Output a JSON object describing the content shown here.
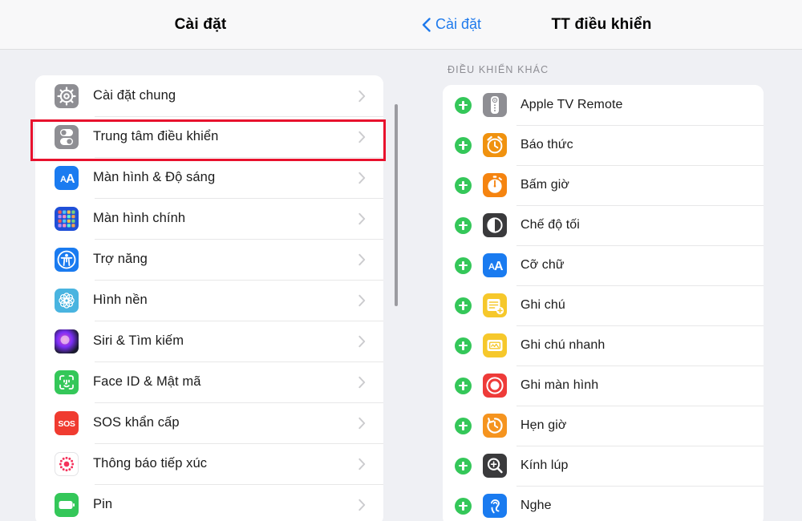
{
  "left_panel": {
    "nav": {
      "title": "Cài đặt"
    },
    "items": [
      {
        "label": "Cài đặt chung",
        "icon": "gear-icon",
        "icon_class": "ic-gear",
        "highlighted": false
      },
      {
        "label": "Trung tâm điều khiển",
        "icon": "control-center-icon",
        "icon_class": "ic-cc",
        "highlighted": true
      },
      {
        "label": "Màn hình & Độ sáng",
        "icon": "display-brightness-icon",
        "icon_class": "ic-aa",
        "highlighted": false
      },
      {
        "label": "Màn hình chính",
        "icon": "home-screen-icon",
        "icon_class": "ic-home",
        "highlighted": false
      },
      {
        "label": "Trợ năng",
        "icon": "accessibility-icon",
        "icon_class": "ic-acc",
        "highlighted": false
      },
      {
        "label": "Hình nền",
        "icon": "wallpaper-icon",
        "icon_class": "ic-wall",
        "highlighted": false
      },
      {
        "label": "Siri & Tìm kiếm",
        "icon": "siri-icon",
        "icon_class": "ic-siri",
        "highlighted": false
      },
      {
        "label": "Face ID & Mật mã",
        "icon": "face-id-icon",
        "icon_class": "ic-face",
        "highlighted": false
      },
      {
        "label": "SOS khẩn cấp",
        "icon": "sos-icon",
        "icon_class": "ic-sos",
        "highlighted": false
      },
      {
        "label": "Thông báo tiếp xúc",
        "icon": "exposure-notification-icon",
        "icon_class": "ic-expo",
        "highlighted": false
      },
      {
        "label": "Pin",
        "icon": "battery-icon",
        "icon_class": "ic-batt",
        "highlighted": false
      }
    ],
    "chevron_icon": "chevron-right-icon"
  },
  "right_panel": {
    "nav": {
      "back_label": "Cài đặt",
      "back_icon": "chevron-left-icon",
      "title": "TT điều khiển"
    },
    "section_header": "ĐIỀU KHIỂN KHÁC",
    "add_icon": "plus-circle-icon",
    "items": [
      {
        "label": "Apple TV Remote",
        "icon": "apple-tv-remote-icon",
        "icon_class": "ic-remote",
        "highlighted": false
      },
      {
        "label": "Báo thức",
        "icon": "alarm-clock-icon",
        "icon_class": "ic-alarm",
        "highlighted": false
      },
      {
        "label": "Bấm giờ",
        "icon": "stopwatch-icon",
        "icon_class": "ic-stop",
        "highlighted": false
      },
      {
        "label": "Chế độ tối",
        "icon": "dark-mode-icon",
        "icon_class": "ic-dark",
        "highlighted": false
      },
      {
        "label": "Cỡ chữ",
        "icon": "text-size-icon",
        "icon_class": "ic-aa",
        "highlighted": false
      },
      {
        "label": "Ghi chú",
        "icon": "notes-icon",
        "icon_class": "ic-notes",
        "highlighted": false
      },
      {
        "label": "Ghi chú nhanh",
        "icon": "quick-note-icon",
        "icon_class": "ic-qnote",
        "highlighted": false
      },
      {
        "label": "Ghi màn hình",
        "icon": "screen-recording-icon",
        "icon_class": "ic-screc",
        "highlighted": true
      },
      {
        "label": "Hẹn giờ",
        "icon": "timer-icon",
        "icon_class": "ic-timer",
        "highlighted": false
      },
      {
        "label": "Kính lúp",
        "icon": "magnifier-icon",
        "icon_class": "ic-magni",
        "highlighted": false
      },
      {
        "label": "Nghe",
        "icon": "hearing-icon",
        "icon_class": "ic-hear",
        "highlighted": false
      }
    ]
  },
  "colors": {
    "highlight_red": "#e8112d",
    "accent_blue": "#1f7aec",
    "add_green": "#34c759",
    "page_background": "#eff0f4",
    "card_background": "#ffffff"
  }
}
